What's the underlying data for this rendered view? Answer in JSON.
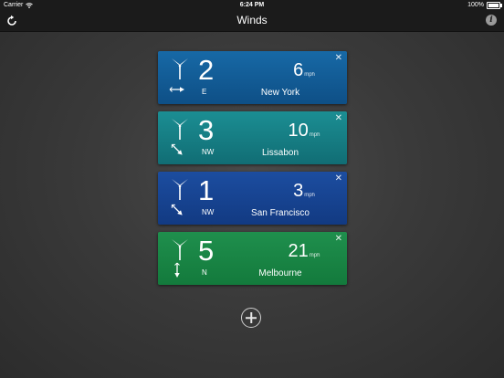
{
  "status": {
    "carrier": "Carrier",
    "time": "6:24 PM",
    "battery": "100%",
    "battery_level": 1.0
  },
  "nav": {
    "title": "Winds",
    "refresh_icon": "refresh-icon",
    "info_icon": "info-icon",
    "info_glyph": "i"
  },
  "cards": [
    {
      "beaufort": "2",
      "direction": "E",
      "speed": "6",
      "unit": "mph",
      "city": "New York",
      "color_top": "#1769a6",
      "color_bottom": "#0e4f86",
      "arrow_deg": 90,
      "close": "✕"
    },
    {
      "beaufort": "3",
      "direction": "NW",
      "speed": "10",
      "unit": "mph",
      "city": "Lissabon",
      "color_top": "#1b8e93",
      "color_bottom": "#116d74",
      "arrow_deg": 135,
      "close": "✕"
    },
    {
      "beaufort": "1",
      "direction": "NW",
      "speed": "3",
      "unit": "mph",
      "city": "San Francisco",
      "color_top": "#1c4da0",
      "color_bottom": "#123a82",
      "arrow_deg": 135,
      "close": "✕"
    },
    {
      "beaufort": "5",
      "direction": "N",
      "speed": "21",
      "unit": "mph",
      "city": "Melbourne",
      "color_top": "#1f8f4d",
      "color_bottom": "#137a3c",
      "arrow_deg": 180,
      "close": "✕"
    }
  ],
  "add_icon": "plus-circle-icon"
}
